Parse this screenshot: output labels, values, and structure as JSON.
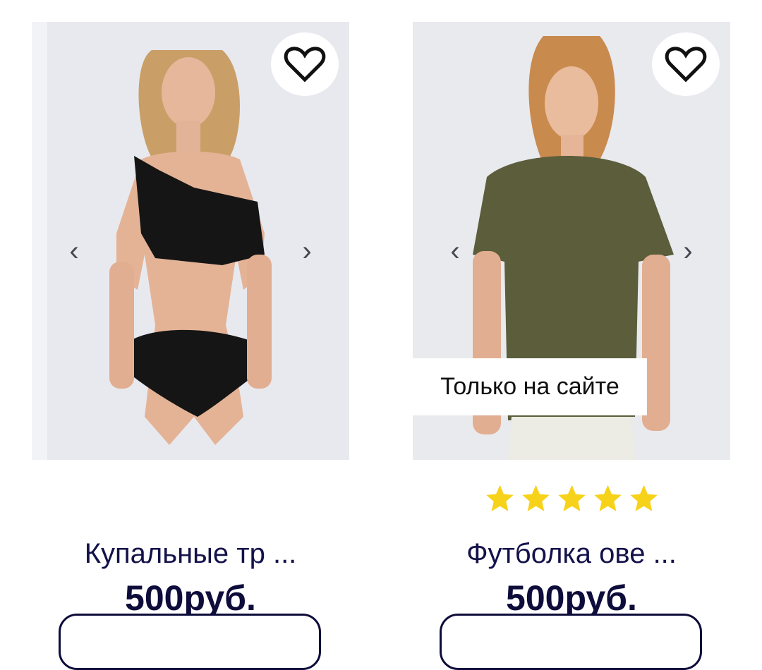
{
  "products": [
    {
      "title": "Купальные тр ...",
      "price": "500руб.",
      "rating": 0,
      "badge": "",
      "prev_icon": "‹",
      "next_icon": "›"
    },
    {
      "title": "Футболка ове ...",
      "price": "500руб.",
      "rating": 5,
      "badge": "Только на сайте",
      "prev_icon": "‹",
      "next_icon": "›"
    }
  ],
  "colors": {
    "text_dark": "#0e0c3a",
    "star": "#f7d21a",
    "shirt": "#5b5d3b"
  }
}
